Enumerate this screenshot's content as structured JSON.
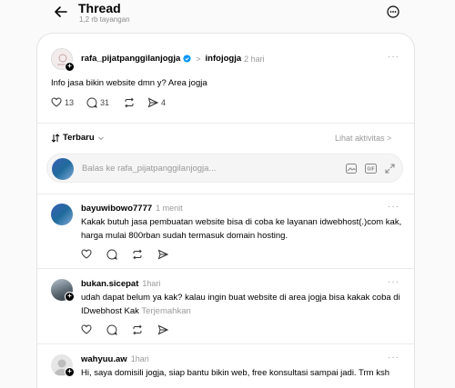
{
  "header": {
    "title": "Thread",
    "views": "1,2 rb tayangan"
  },
  "post": {
    "username": "rafa_pijatpanggilanjogja",
    "separator": ">",
    "community": "infojogja",
    "time": "2 hari",
    "text": "Info jasa bikin website dmn y? Area jogja",
    "likes": "13",
    "comments": "31",
    "shares": "4"
  },
  "sort": {
    "label": "Terbaru",
    "activity": "Lihat aktivitas >"
  },
  "reply_box": {
    "placeholder": "Balas ke rafa_pijatpanggilanjogja..."
  },
  "replies": [
    {
      "username": "bayuwibowo7777",
      "time": "1 menit",
      "text": "Kakak butuh jasa pembuatan website bisa di coba ke layanan idwebhost(.)com kak, harga mulai 800rban sudah termasuk domain hosting."
    },
    {
      "username": "bukan.sicepat",
      "time": "1hari",
      "text": "udah dapat belum ya kak? kalau ingin buat website di area jogja bisa kakak coba di IDwebhost Kak",
      "translate": "Terjemahkan"
    },
    {
      "username": "wahyuu.aw",
      "time": "1hari",
      "text": "Hi, saya domisili jogja, siap bantu bikin web, free konsultasi sampai jadi. Trm ksh"
    }
  ],
  "colors": {
    "verified": "#0095f6",
    "muted": "#9a9a9a",
    "border": "#e3e3e3"
  },
  "icons": [
    "back-arrow-icon",
    "more-circle-icon",
    "heart-icon",
    "comment-icon",
    "repost-icon",
    "share-icon",
    "gif-icon",
    "image-icon",
    "expand-icon",
    "verified-icon",
    "sort-icon",
    "chevron-down-icon"
  ]
}
